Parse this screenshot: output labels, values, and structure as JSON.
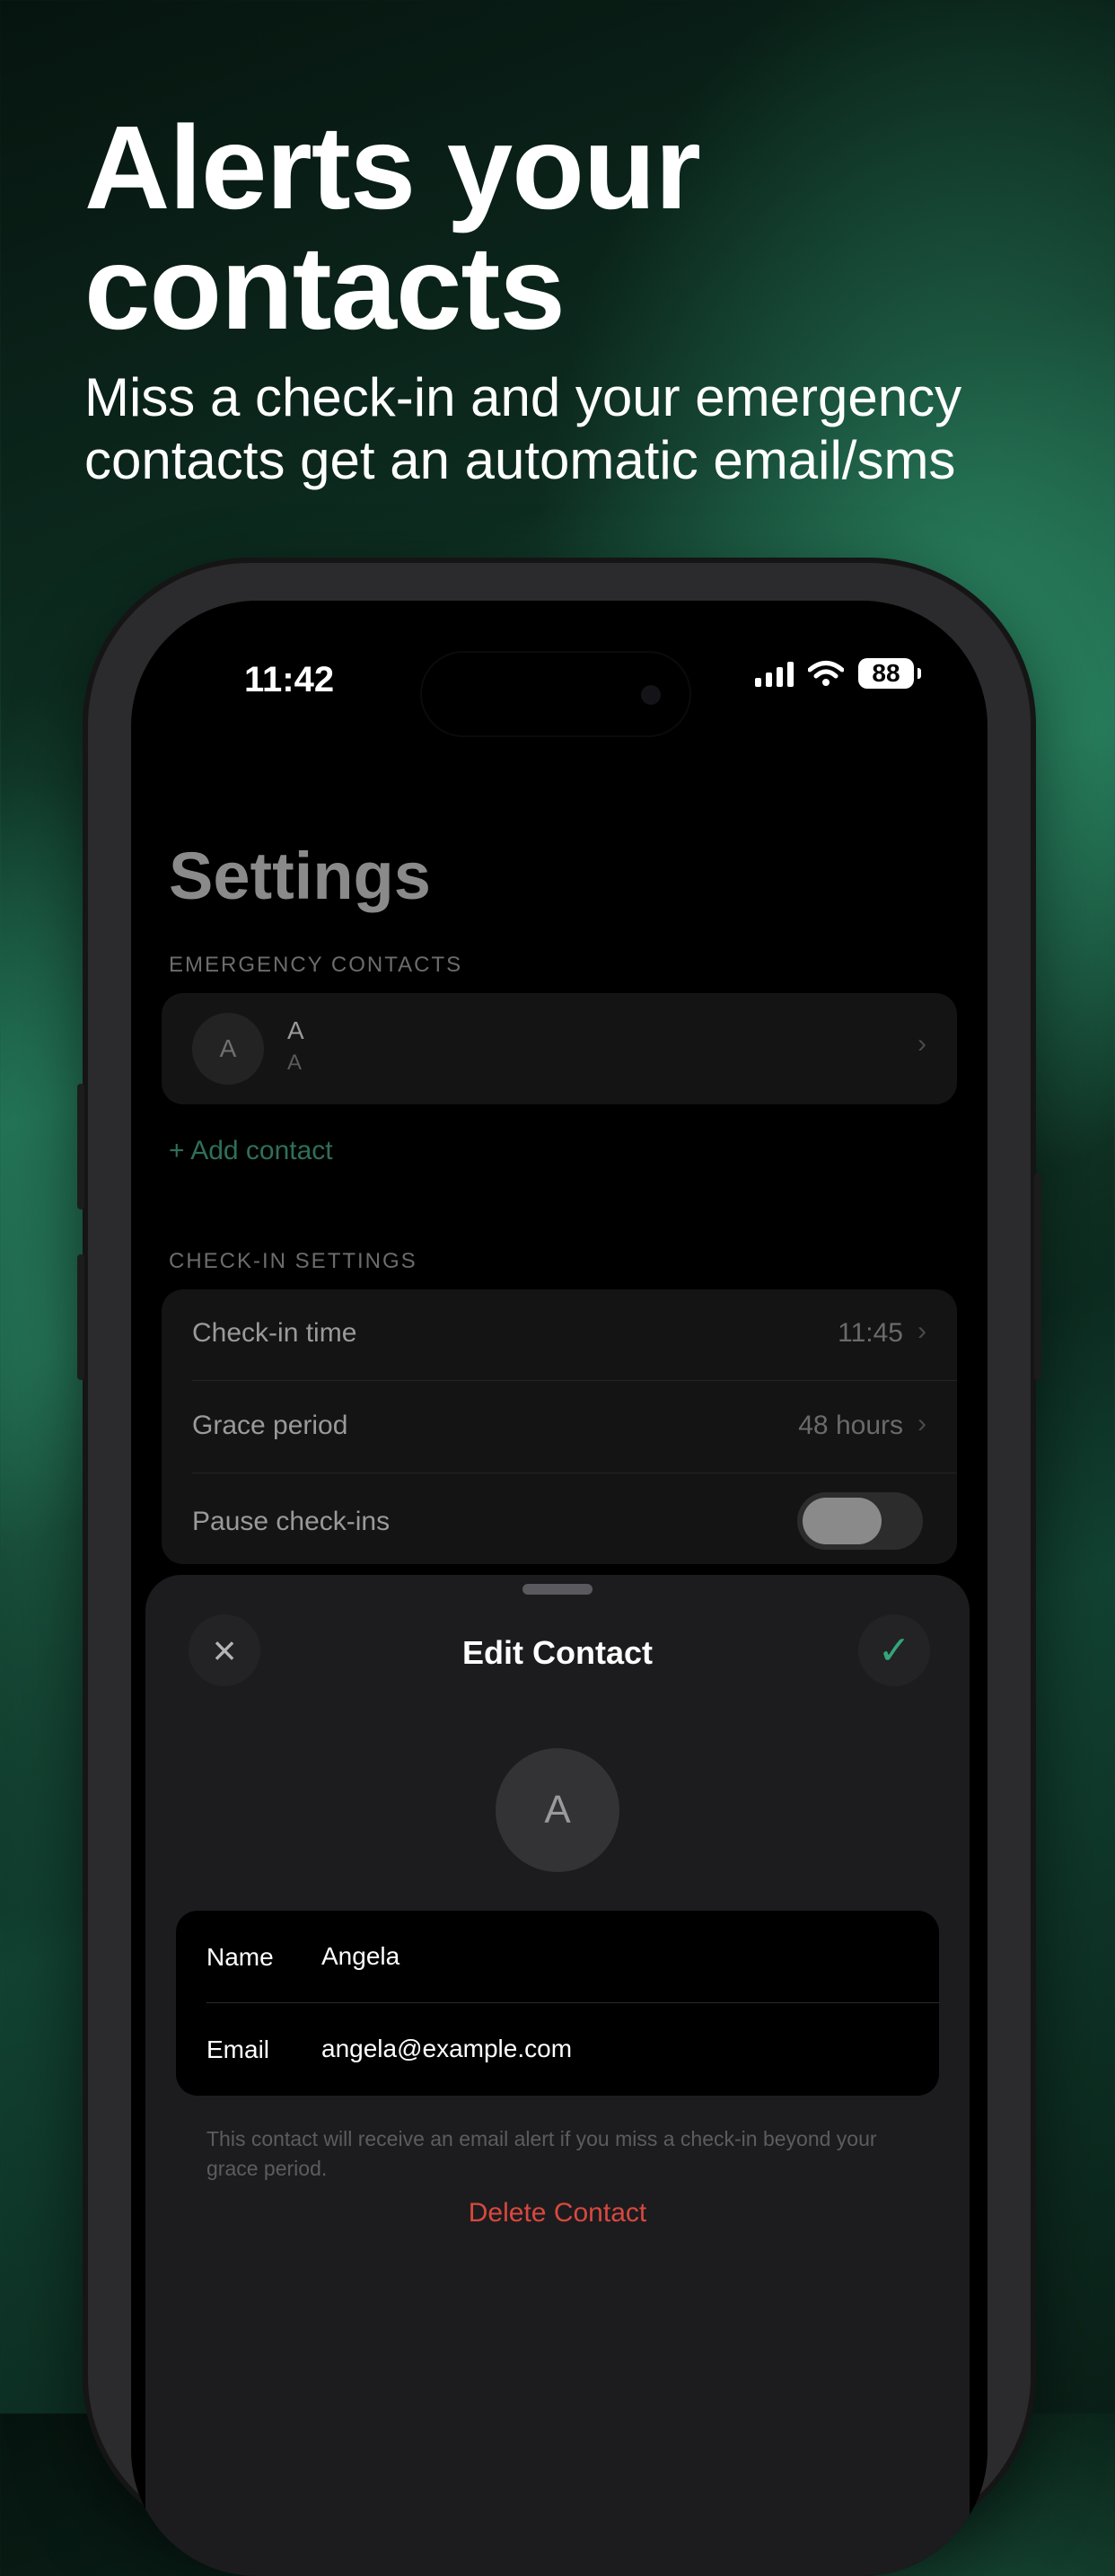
{
  "headline": {
    "line1": "Alerts your",
    "line2": "contacts"
  },
  "subline": "Miss a check-in and your emergency contacts get an automatic email/sms",
  "status_bar": {
    "time": "11:42",
    "battery": "88"
  },
  "settings": {
    "title": "Settings",
    "emergency_label": "EMERGENCY CONTACTS",
    "contact": {
      "avatar": "A",
      "name": "A",
      "sub": "A"
    },
    "add_contact": "Add contact",
    "checkin_label": "CHECK-IN SETTINGS",
    "rows": [
      {
        "label": "Check-in time",
        "value": "11:45"
      },
      {
        "label": "Grace period",
        "value": "48 hours"
      },
      {
        "label": "Pause check-ins"
      }
    ]
  },
  "sheet": {
    "title": "Edit Contact",
    "avatar": "A",
    "name_label": "Name",
    "name_value": "Angela",
    "email_label": "Email",
    "email_value": "angela@example.com",
    "help": "This contact will receive an email alert if you miss a check-in beyond your grace period.",
    "delete": "Delete Contact"
  },
  "icons": {
    "close": "close-icon",
    "confirm": "checkmark-icon",
    "add": "plus-icon",
    "chevron": "chevron-right-icon"
  },
  "colors": {
    "accent": "#34a57b",
    "danger": "#d9483f"
  }
}
